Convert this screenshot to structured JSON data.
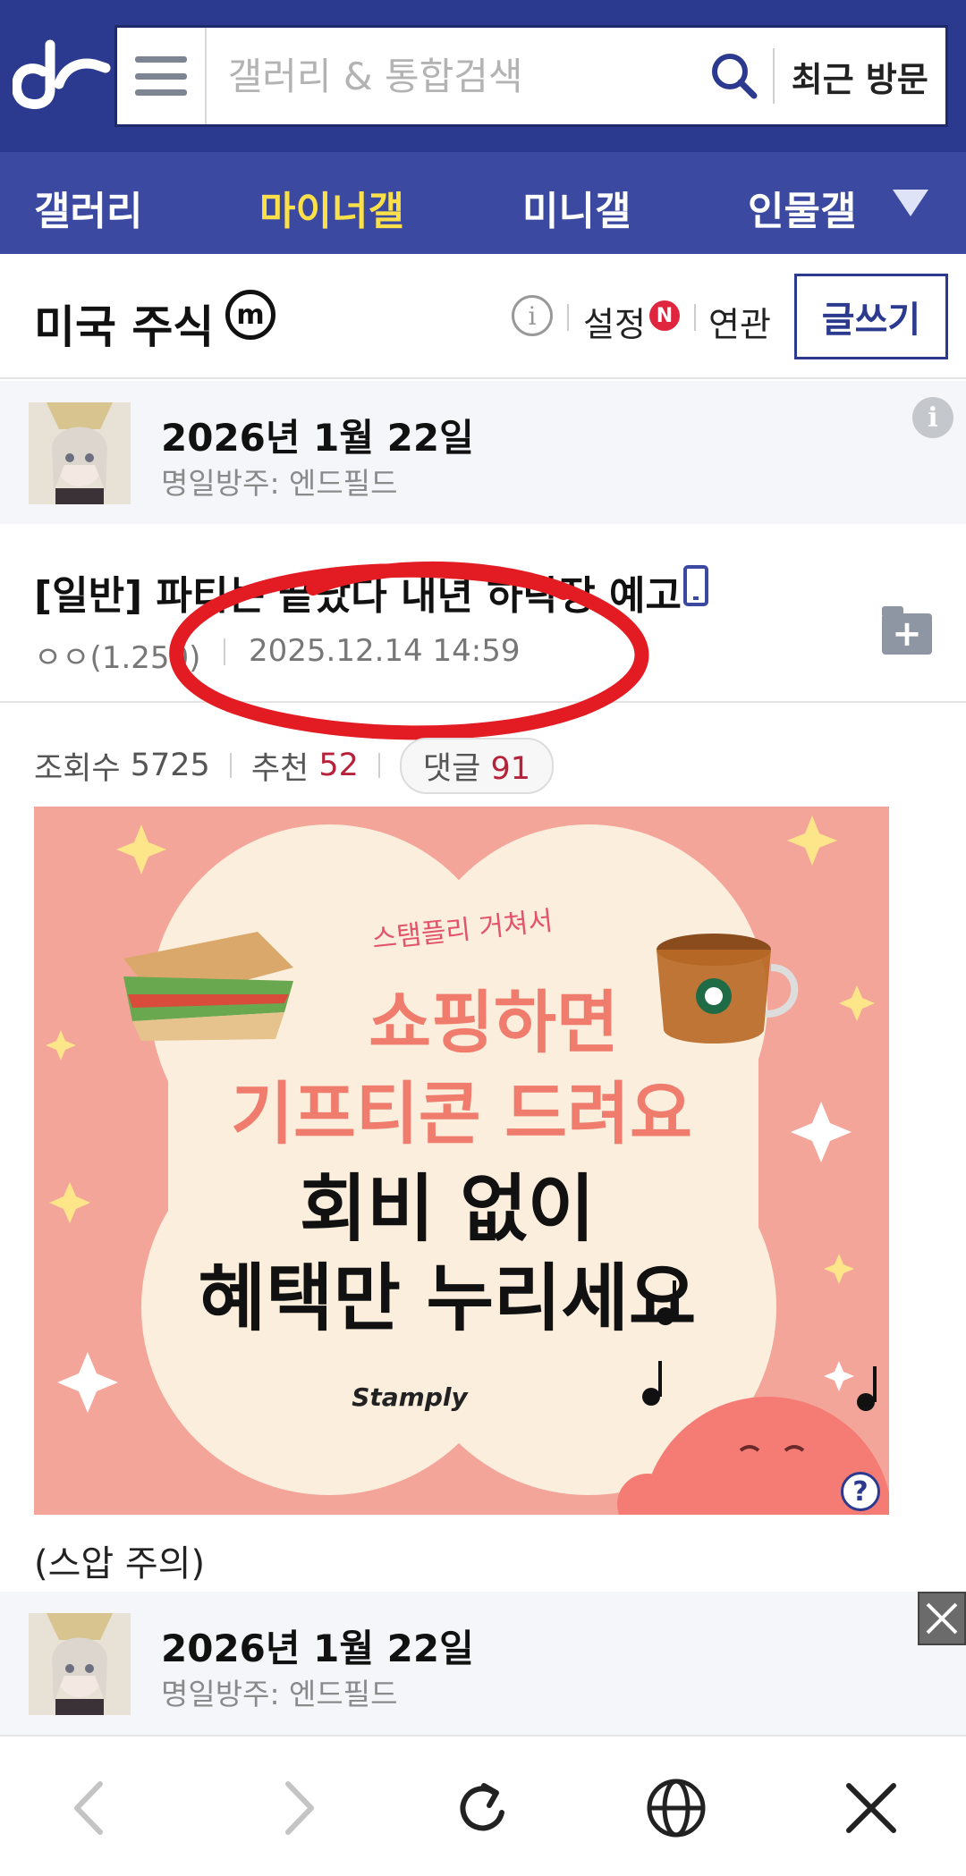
{
  "header": {
    "search_placeholder": "갤러리 & 통합검색",
    "recent_label": "최근 방문"
  },
  "nav": {
    "items": [
      "갤러리",
      "마이너갤",
      "미니갤",
      "인물갤"
    ],
    "active_index": 1
  },
  "gallery": {
    "title": "미국 주식",
    "badge": "m",
    "settings_label": "설정",
    "settings_badge": "N",
    "related_label": "연관",
    "write_label": "글쓰기"
  },
  "promo": {
    "date": "2026년 1월 22일",
    "subtitle": "명일방주: 엔드필드",
    "info_icon": "i"
  },
  "post": {
    "title": "[일반] 파티는 끝났다 내년 하락장 예고",
    "author": "ㅇㅇ(1.250)",
    "date": "2025.12.14 14:59",
    "stats": {
      "views_label": "조회수",
      "views": "5725",
      "recommend_label": "추천",
      "recommend": "52",
      "comments_label": "댓글",
      "comments": "91"
    },
    "caption": "(스압 주의)"
  },
  "ad": {
    "kicker": "스탬플리 거쳐서",
    "line1": "쇼핑하면",
    "line2": "기프티콘 드려요",
    "line3": "회비 없이",
    "line4": "혜택만 누리세요",
    "brand": "Stamply",
    "help": "?"
  },
  "promo_bottom": {
    "date": "2026년 1월 22일",
    "subtitle": "명일방주: 엔드필드"
  },
  "colors": {
    "header_bg": "#2b3a8f",
    "nav_bg": "#3b4aa0",
    "nav_active": "#fbe04a",
    "accent_red": "#b8213a",
    "ad_bg": "#f4a599",
    "ad_cream": "#fbeedd",
    "ad_pink_text": "#ef7c6d"
  },
  "icons": {
    "logo": "dc-logo",
    "menu": "hamburger-icon",
    "search": "search-icon",
    "dropdown": "triangle-down-icon",
    "back": "chevron-left-icon",
    "forward": "chevron-right-icon",
    "reload": "reload-icon",
    "globe": "globe-icon",
    "close": "close-icon"
  }
}
